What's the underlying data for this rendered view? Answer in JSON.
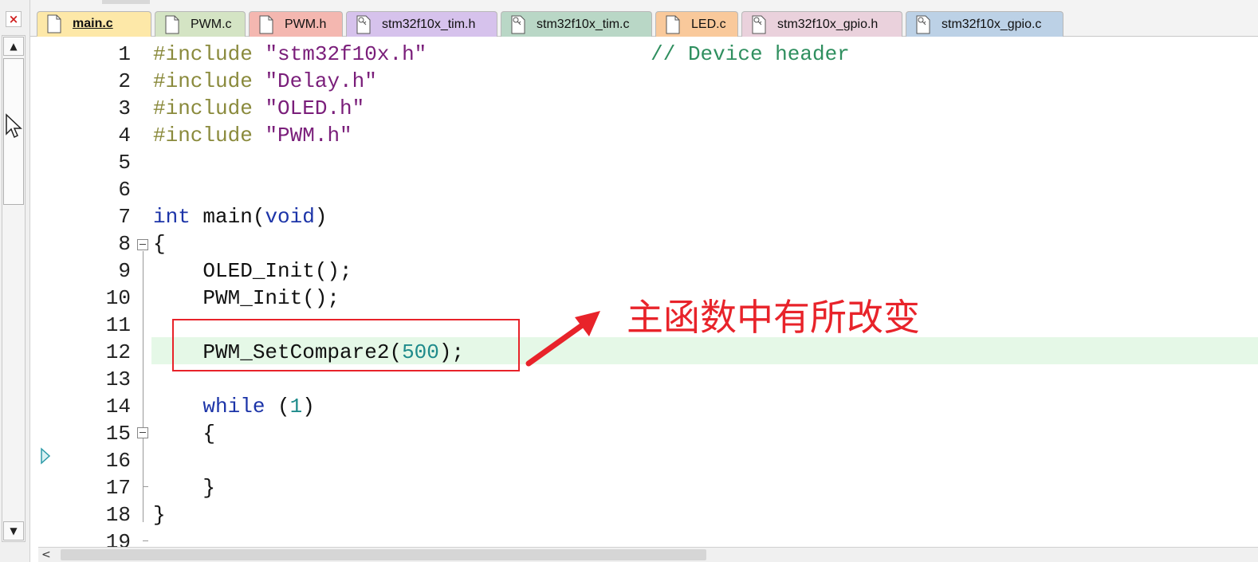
{
  "left_panel": {
    "close_label": "×"
  },
  "tabs": [
    {
      "label": "main.c",
      "icon": "file-icon",
      "color": "#fde8a8",
      "active": true
    },
    {
      "label": "PWM.c",
      "icon": "file-icon",
      "color": "#d4e4c4",
      "active": false
    },
    {
      "label": "PWM.h",
      "icon": "file-icon",
      "color": "#f4b7b0",
      "active": false
    },
    {
      "label": "stm32f10x_tim.h",
      "icon": "key-file-icon",
      "color": "#d6c2ec",
      "active": false
    },
    {
      "label": "stm32f10x_tim.c",
      "icon": "key-file-icon",
      "color": "#b9d7c6",
      "active": false
    },
    {
      "label": "LED.c",
      "icon": "file-icon",
      "color": "#f9c99b",
      "active": false
    },
    {
      "label": "stm32f10x_gpio.h",
      "icon": "key-file-icon",
      "color": "#ead1dc",
      "active": false
    },
    {
      "label": "stm32f10x_gpio.c",
      "icon": "key-file-icon",
      "color": "#bcd1e6",
      "active": false
    }
  ],
  "editor": {
    "line_numbers": [
      "1",
      "2",
      "3",
      "4",
      "5",
      "6",
      "7",
      "8",
      "9",
      "10",
      "11",
      "12",
      "13",
      "14",
      "15",
      "16",
      "17",
      "18",
      "19"
    ],
    "code": {
      "l1_pp": "#include ",
      "l1_str": "\"stm32f10x.h\"",
      "l1_pad": "                  ",
      "l1_comment": "// Device header",
      "l2_pp": "#include ",
      "l2_str": "\"Delay.h\"",
      "l3_pp": "#include ",
      "l3_str": "\"OLED.h\"",
      "l4_pp": "#include ",
      "l4_str": "\"PWM.h\"",
      "l7_type": "int",
      "l7_name": " main(",
      "l7_void": "void",
      "l7_close": ")",
      "l8": "{",
      "l9": "    OLED_Init();",
      "l10": "    PWM_Init();",
      "l12_fn": "    PWM_SetCompare2(",
      "l12_num": "500",
      "l12_end": ");",
      "l14_kw": "    while",
      "l14_open": " (",
      "l14_num": "1",
      "l14_close": ")",
      "l15": "    {",
      "l17": "    }",
      "l18": "}"
    },
    "highlight_color": "#e5f8e7"
  },
  "annotation": {
    "text": "主函数中有所改变",
    "color": "#e8232a"
  },
  "scrollbar": {
    "left_arrow": "<"
  }
}
